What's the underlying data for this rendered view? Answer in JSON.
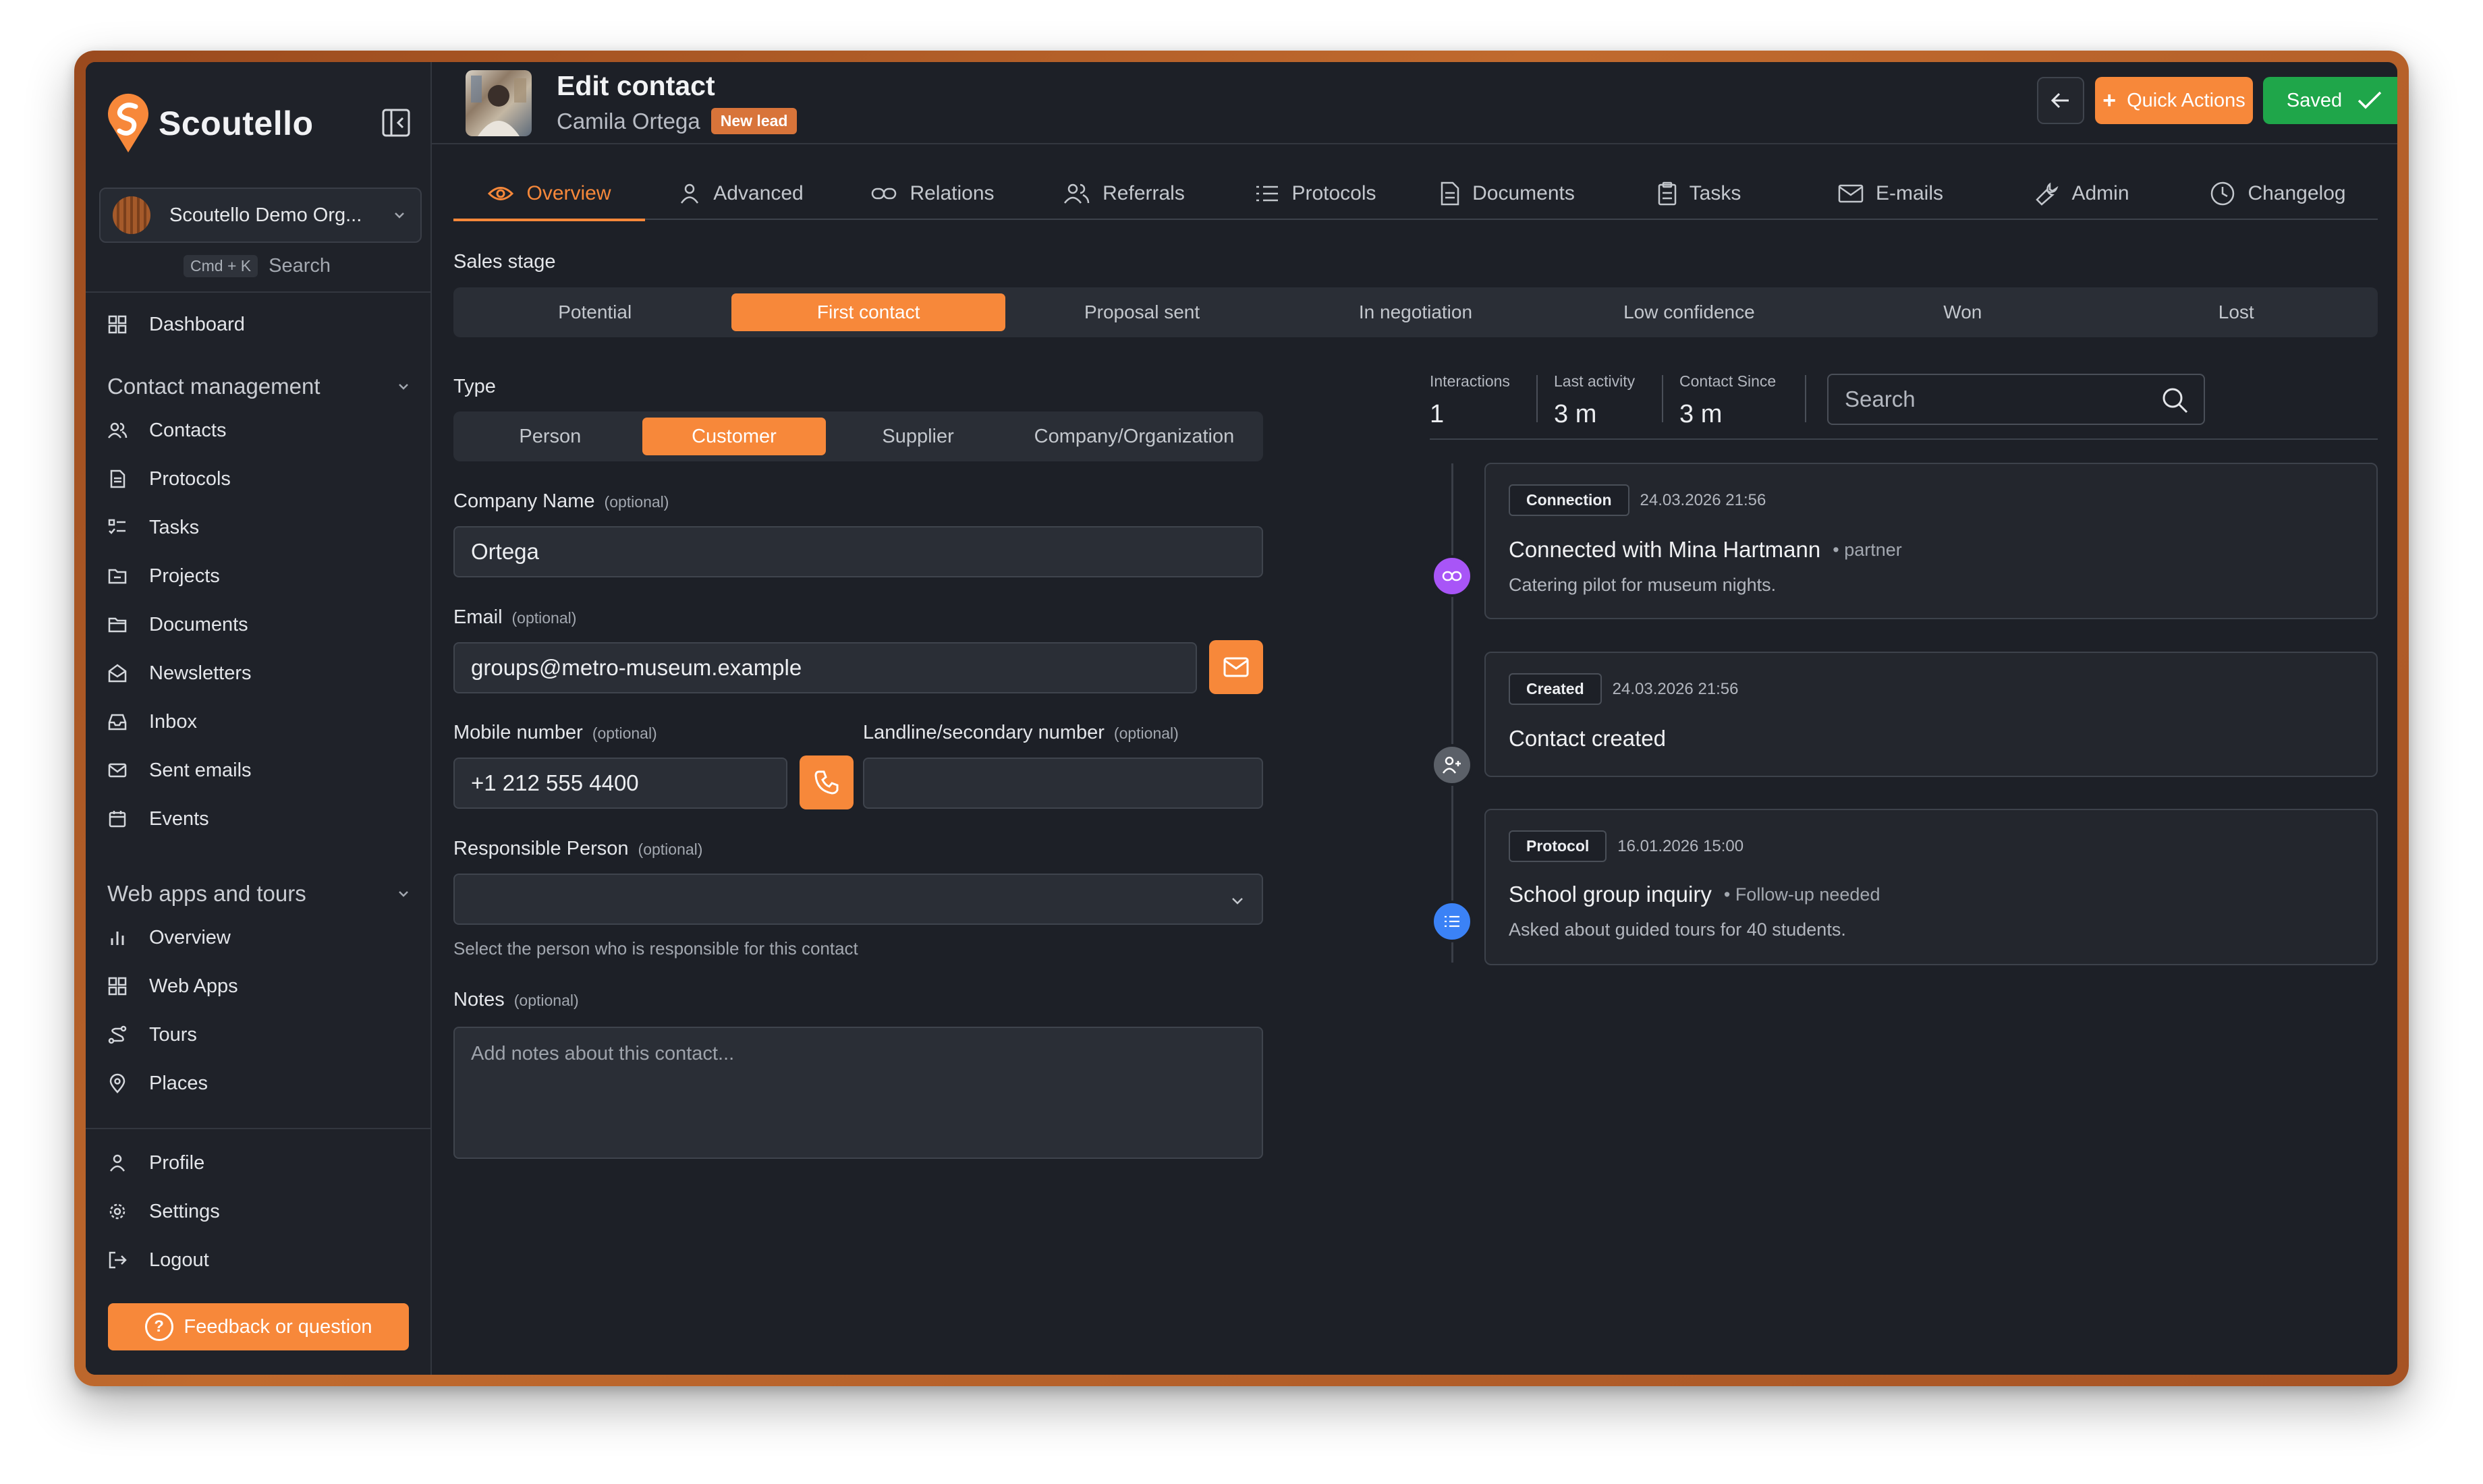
{
  "app": {
    "name": "Scoutello"
  },
  "org": {
    "name": "Scoutello Demo Org..."
  },
  "search_hint": {
    "kbd": "Cmd + K",
    "label": "Search"
  },
  "nav": {
    "dashboard": "Dashboard",
    "contact_management": {
      "title": "Contact management",
      "items": [
        "Contacts",
        "Protocols",
        "Tasks",
        "Projects",
        "Documents",
        "Newsletters",
        "Inbox",
        "Sent emails",
        "Events"
      ]
    },
    "web_apps": {
      "title": "Web apps and tours",
      "items": [
        "Overview",
        "Web Apps",
        "Tours",
        "Places"
      ]
    },
    "bottom": [
      "Profile",
      "Settings",
      "Logout"
    ],
    "feedback": "Feedback or question"
  },
  "header": {
    "title": "Edit contact",
    "contact_name": "Camila Ortega",
    "badge": "New lead",
    "quick_actions": "Quick Actions",
    "saved": "Saved"
  },
  "tabs": [
    "Overview",
    "Advanced",
    "Relations",
    "Referrals",
    "Protocols",
    "Documents",
    "Tasks",
    "E-mails",
    "Admin",
    "Changelog"
  ],
  "sales_stage": {
    "label": "Sales stage",
    "stages": [
      "Potential",
      "First contact",
      "Proposal sent",
      "In negotiation",
      "Low confidence",
      "Won",
      "Lost"
    ],
    "selected": "First contact"
  },
  "form": {
    "type_label": "Type",
    "types": [
      "Person",
      "Customer",
      "Supplier",
      "Company/Organization"
    ],
    "selected_type": "Customer",
    "optional": "(optional)",
    "company_label": "Company Name",
    "company_value": "Ortega",
    "email_label": "Email",
    "email_value": "groups@metro-museum.example",
    "mobile_label": "Mobile number",
    "mobile_value": "+1 212 555 4400",
    "landline_label": "Landline/secondary number",
    "landline_value": "",
    "responsible_label": "Responsible Person",
    "responsible_help": "Select the person who is responsible for this contact",
    "notes_label": "Notes",
    "notes_placeholder": "Add notes about this contact..."
  },
  "stats": {
    "interactions_label": "Interactions",
    "interactions": "1",
    "last_activity_label": "Last activity",
    "last_activity": "3 m",
    "contact_since_label": "Contact Since",
    "contact_since": "3 m"
  },
  "activity_search": {
    "placeholder": "Search"
  },
  "timeline": [
    {
      "chip": "Connection",
      "date": "24.03.2026 21:56",
      "title": "Connected with Mina Hartmann",
      "tag": "• partner",
      "desc": "Catering pilot for museum nights.",
      "color": "#a855f7"
    },
    {
      "chip": "Created",
      "date": "24.03.2026 21:56",
      "title": "Contact created",
      "tag": "",
      "desc": "",
      "color": "#5b6068"
    },
    {
      "chip": "Protocol",
      "date": "16.01.2026 15:00",
      "title": "School group inquiry",
      "tag": "• Follow-up needed",
      "desc": "Asked about guided tours for 40 students.",
      "color": "#3b82f6"
    }
  ],
  "colors": {
    "accent": "#f7883a",
    "success": "#1fa64a",
    "background": "#1d2027"
  }
}
